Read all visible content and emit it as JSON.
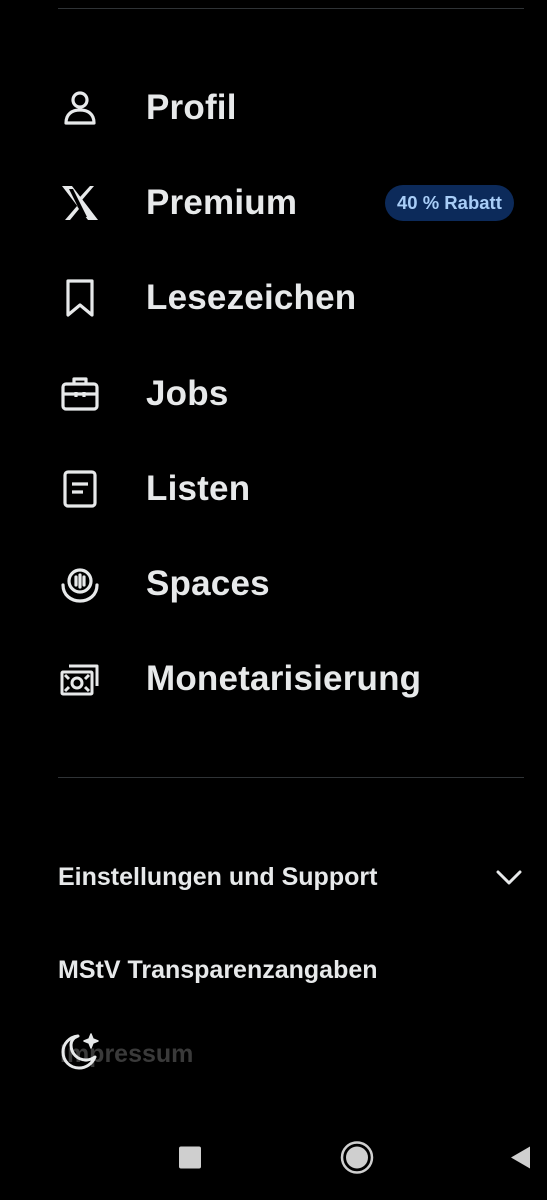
{
  "menu": {
    "items": [
      {
        "label": "Profil",
        "icon": "person-icon"
      },
      {
        "label": "Premium",
        "icon": "x-logo-icon",
        "badge": "40 % Rabatt"
      },
      {
        "label": "Lesezeichen",
        "icon": "bookmark-icon"
      },
      {
        "label": "Jobs",
        "icon": "briefcase-icon"
      },
      {
        "label": "Listen",
        "icon": "list-icon"
      },
      {
        "label": "Spaces",
        "icon": "spaces-microphone-icon"
      },
      {
        "label": "Monetarisierung",
        "icon": "money-icon"
      }
    ]
  },
  "sections": {
    "settings_support": "Einstellungen und Support",
    "transparency": "MStV Transparenzangaben",
    "imprint": "Impressum"
  },
  "theme": {
    "icon": "moon-sparkle-icon"
  },
  "system_nav": {
    "recents": "square-icon",
    "home": "circle-icon",
    "back": "triangle-back-icon"
  },
  "colors": {
    "background": "#000000",
    "text": "#e7e9ea",
    "divider": "#2f3336",
    "badge_bg": "#0c2a5a",
    "badge_text": "#a8cdf7"
  }
}
